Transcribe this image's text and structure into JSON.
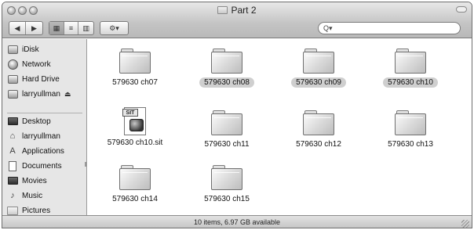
{
  "window": {
    "title": "Part 2"
  },
  "toolbar": {
    "back_glyph": "◀",
    "forward_glyph": "▶",
    "view_icons": [
      "icon-view-icon",
      "list-view-icon",
      "column-view-icon"
    ],
    "view_glyphs": [
      "▦",
      "≡",
      "▥"
    ],
    "action_glyph": "⚙▾",
    "search_glyph": "Q▾",
    "search_value": ""
  },
  "sidebar": {
    "devices": [
      {
        "label": "iDisk",
        "icon": "idisk-icon"
      },
      {
        "label": "Network",
        "icon": "network-icon"
      },
      {
        "label": "Hard Drive",
        "icon": "hard-drive-icon"
      },
      {
        "label": "larryullman",
        "icon": "user-disk-icon",
        "eject": "⏏"
      }
    ],
    "places": [
      {
        "label": "Desktop",
        "icon": "desktop-icon"
      },
      {
        "label": "larryullman",
        "icon": "home-icon"
      },
      {
        "label": "Applications",
        "icon": "applications-icon"
      },
      {
        "label": "Documents",
        "icon": "documents-icon"
      },
      {
        "label": "Movies",
        "icon": "movies-icon"
      },
      {
        "label": "Music",
        "icon": "music-icon"
      },
      {
        "label": "Pictures",
        "icon": "pictures-icon"
      }
    ]
  },
  "items": [
    {
      "name": "579630 ch07",
      "kind": "folder",
      "tagged": false
    },
    {
      "name": "579630 ch08",
      "kind": "folder",
      "tagged": true
    },
    {
      "name": "579630 ch09",
      "kind": "folder",
      "tagged": true
    },
    {
      "name": "579630 ch10",
      "kind": "folder",
      "tagged": true
    },
    {
      "name": "579630 ch10.sit",
      "kind": "archive",
      "badge": "SIT",
      "tagged": false
    },
    {
      "name": "579630 ch11",
      "kind": "folder",
      "tagged": false
    },
    {
      "name": "579630 ch12",
      "kind": "folder",
      "tagged": false
    },
    {
      "name": "579630 ch13",
      "kind": "folder",
      "tagged": false
    },
    {
      "name": "579630 ch14",
      "kind": "folder",
      "tagged": false
    },
    {
      "name": "579630 ch15",
      "kind": "folder",
      "tagged": false
    }
  ],
  "status": {
    "text": "10 items, 6.97 GB available"
  }
}
